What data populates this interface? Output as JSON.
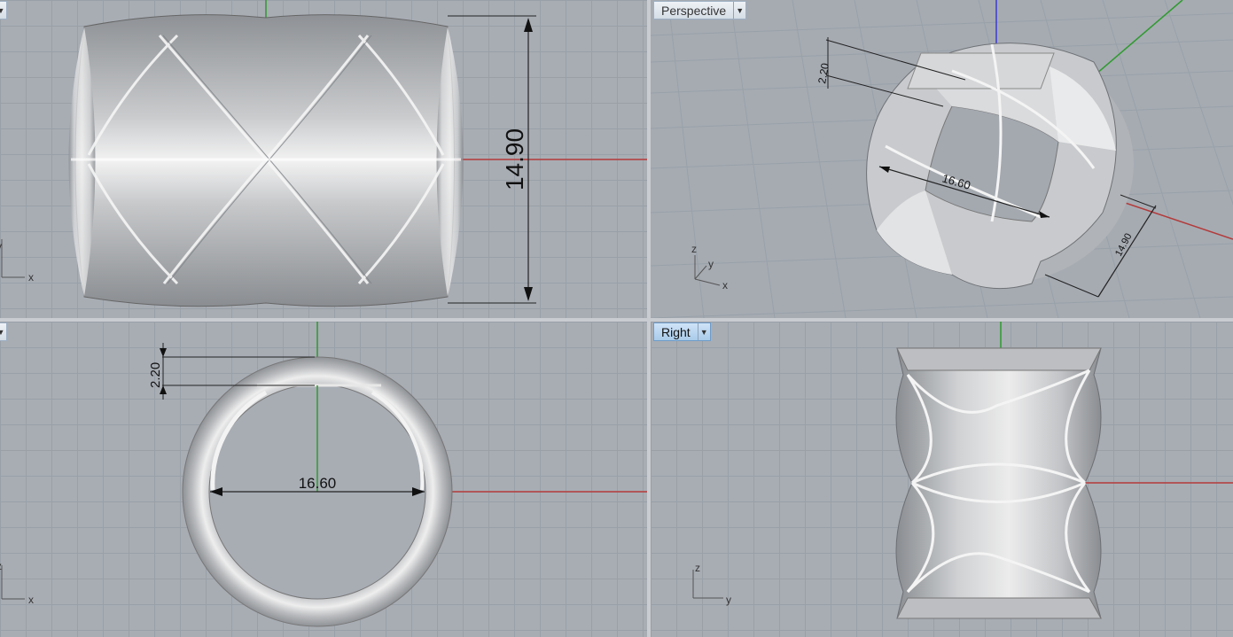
{
  "viewports": {
    "top": {
      "label": "",
      "dimension": "14.90",
      "axes": {
        "h": "x",
        "v": "y"
      }
    },
    "perspective": {
      "label": "Perspective",
      "dimensions": {
        "thickness": "2.20",
        "diameter": "16.60",
        "width": "14.90"
      },
      "axes": {
        "z": "z",
        "y": "y",
        "x": "x"
      }
    },
    "front": {
      "label": "",
      "dimensions": {
        "thickness": "2.20",
        "diameter": "16.60"
      },
      "axes": {
        "h": "x",
        "v": "z"
      }
    },
    "right": {
      "label": "Right",
      "axes": {
        "h": "y",
        "v": "z"
      }
    }
  },
  "colors": {
    "viewport_bg": "#a8adb4",
    "grid": "#9aa0a7",
    "x_axis": "#b43a3a",
    "y_axis": "#2f9a2f",
    "z_axis": "#3b3bd0",
    "active_tab": "#a9cbea"
  },
  "icons": {
    "dropdown": "caret-down"
  }
}
